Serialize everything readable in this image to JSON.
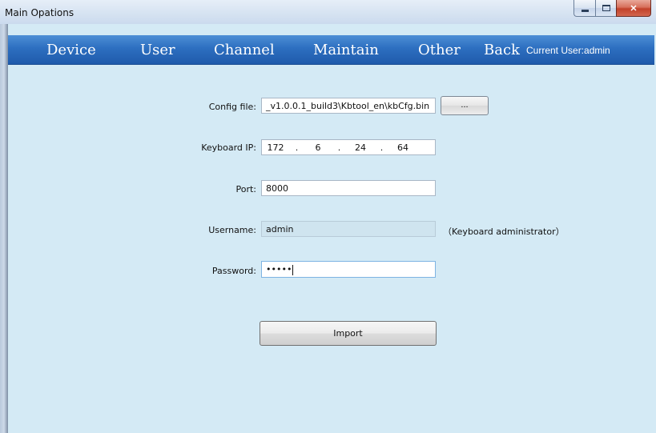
{
  "window": {
    "title": "Main Opations"
  },
  "nav": {
    "items": [
      "Device",
      "User",
      "Channel",
      "Maintain",
      "Other",
      "Back"
    ],
    "current_user": "Current User:admin"
  },
  "form": {
    "config_label": "Config file:",
    "config_value": "_v1.0.0.1_build3\\Kbtool_en\\kbCfg.bin",
    "browse_label": "...",
    "ip_label": "Keyboard IP:",
    "ip_segments": [
      "172",
      "6",
      "24",
      "64"
    ],
    "ip_separator": ".",
    "port_label": "Port:",
    "port_value": "8000",
    "username_label": "Username:",
    "username_value": "admin",
    "username_note": "（Keyboard administrator）",
    "password_label": "Password:",
    "password_value": "•••••",
    "import_label": "Import"
  },
  "colors": {
    "nav_bar": "#2d6fc0",
    "background": "#d4eaf5",
    "close_button": "#c2412a"
  }
}
